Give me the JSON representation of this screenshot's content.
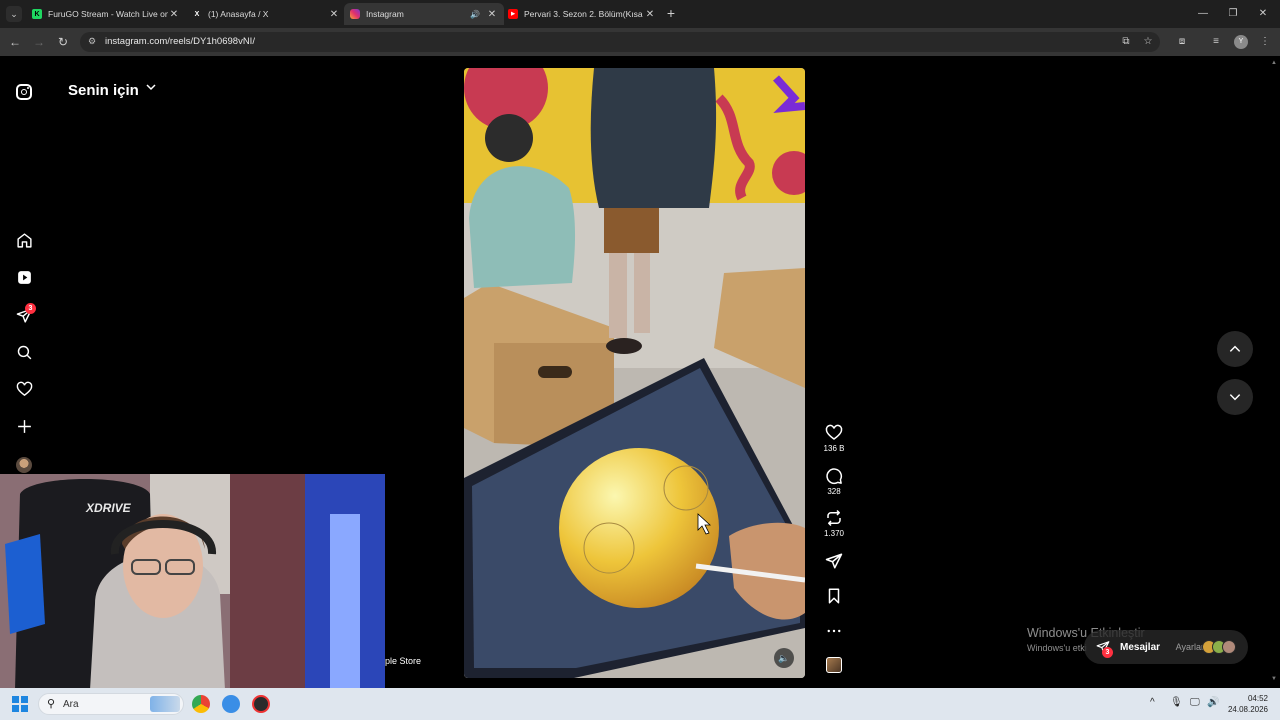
{
  "browser": {
    "tabs": [
      {
        "title": "FuruGO Stream - Watch Live on",
        "favicon_color": "#1ed760",
        "favicon_glyph": "K",
        "active": false
      },
      {
        "title": "(1) Anasayfa / X",
        "favicon_color": "#000000",
        "favicon_glyph": "X",
        "active": false
      },
      {
        "title": "Instagram",
        "favicon_color": "#e1306c",
        "favicon_glyph": "",
        "active": true,
        "audio": true
      },
      {
        "title": "Pervari 3. Sezon 2. Bölüm(Kısa",
        "favicon_color": "#ff0000",
        "favicon_glyph": "▶",
        "active": false
      }
    ],
    "url": "instagram.com/reels/DY1h0698vNI/",
    "profile_initial": "Y"
  },
  "instagram": {
    "feed_title": "Senin için",
    "sidebar_icons": [
      "home-icon",
      "reels-icon",
      "messages-icon",
      "search-icon",
      "notifications-icon",
      "create-icon",
      "profile-avatar"
    ],
    "messages_badge": "3",
    "reel": {
      "likes": "136 B",
      "comments": "328",
      "reposts": "1.370"
    }
  },
  "webcam": {
    "chair_brand": "XDRIVE"
  },
  "partial_label": "ple Store",
  "os_overlay": {
    "activate_title": "Windows'u Etkinleştir",
    "activate_sub": "Windows'u etki",
    "activate_sub_tail": "Ayarlar",
    "messages_label": "Mesajlar",
    "messages_badge": "3"
  },
  "taskbar": {
    "search_placeholder": "Ara",
    "time": "04:52",
    "date": "24.08.2026"
  },
  "colors": {
    "accent_red": "#ff3040",
    "background": "#000000",
    "windows_blue": "#1e86e0"
  }
}
